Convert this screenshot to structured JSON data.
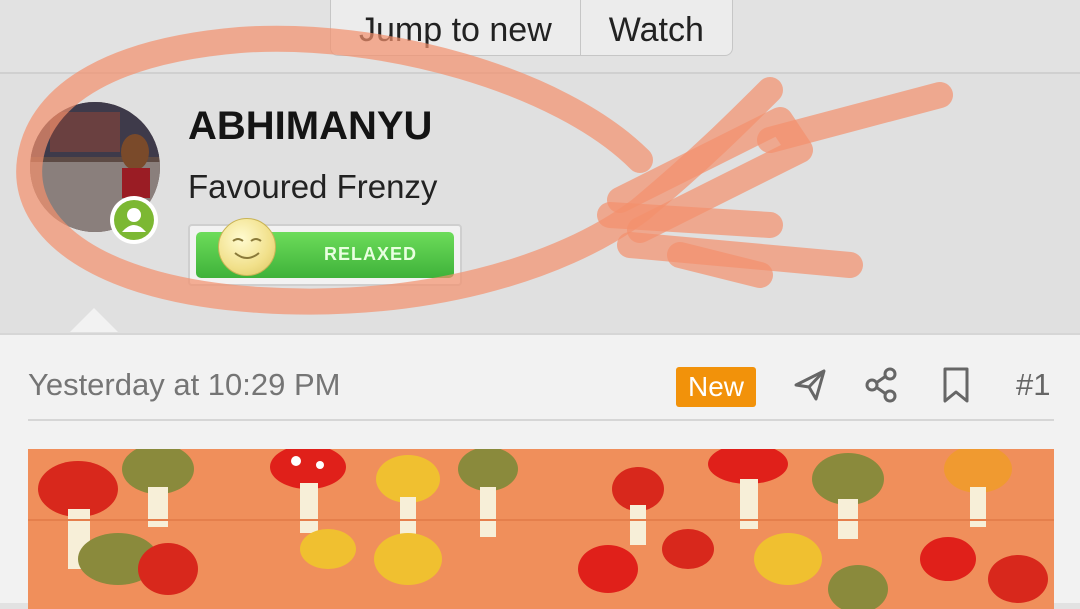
{
  "topbar": {
    "buttons": [
      {
        "label": "Jump to new"
      },
      {
        "label": "Watch"
      }
    ]
  },
  "user": {
    "username": "ABHIMANYU",
    "title": "Favoured Frenzy",
    "mood": {
      "label": "RELAXED",
      "color": "#44b43c"
    },
    "online_color": "#7cb833"
  },
  "post": {
    "date": "Yesterday at 10:29 PM",
    "badge": "New",
    "badge_color": "#f2920a",
    "number": "#1",
    "actions": [
      "share-send-icon",
      "share-icon",
      "bookmark-icon"
    ]
  },
  "annotation_color": "#f59a7a"
}
